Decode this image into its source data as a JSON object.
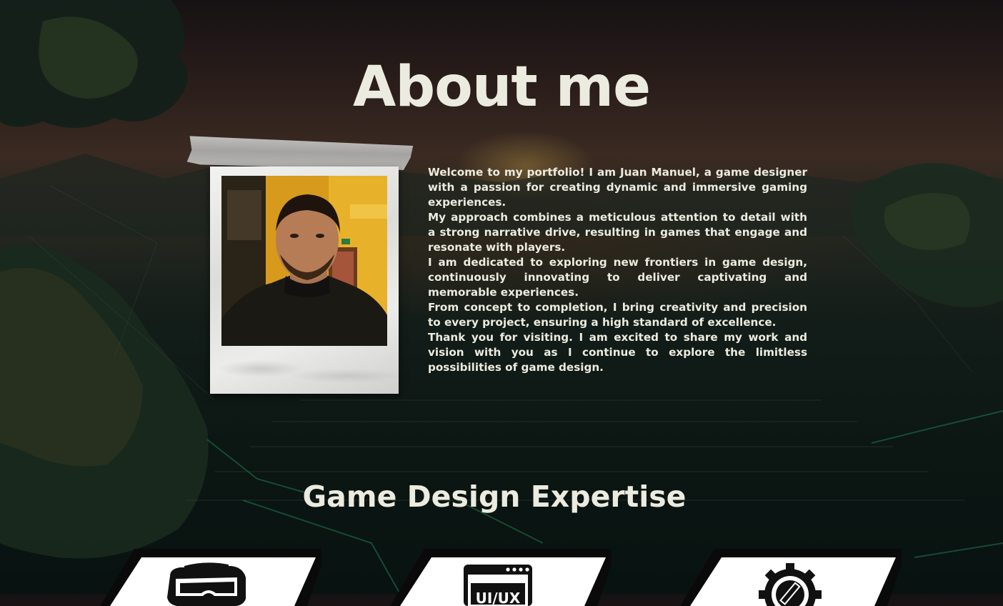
{
  "about": {
    "title": "About me",
    "paragraphs": [
      "Welcome to my portfolio! I am Juan Manuel, a game designer with a passion for creating dynamic and immersive gaming experiences.",
      "My approach combines a meticulous attention to detail with a strong narrative drive, resulting in games that engage and resonate with players.",
      "I am dedicated to exploring new frontiers in game design, continuously innovating to deliver captivating and memorable experiences.",
      "From concept to completion, I bring creativity and precision to every project, ensuring a high standard of excellence.",
      "Thank you for visiting. I am excited to share my work and vision with you as I continue to explore the limitless possibilities of game design."
    ]
  },
  "expertise": {
    "title": "Game Design Expertise",
    "cards": [
      {
        "icon": "vr-headset-icon"
      },
      {
        "icon": "ui-ux-browser-icon",
        "icon_text": "UI/UX"
      },
      {
        "icon": "gear-pencil-icon"
      }
    ]
  },
  "colors": {
    "text": "#ecebdf",
    "card_fill": "#ffffff",
    "card_shadow": "#0a0a0a",
    "icon": "#111111"
  }
}
